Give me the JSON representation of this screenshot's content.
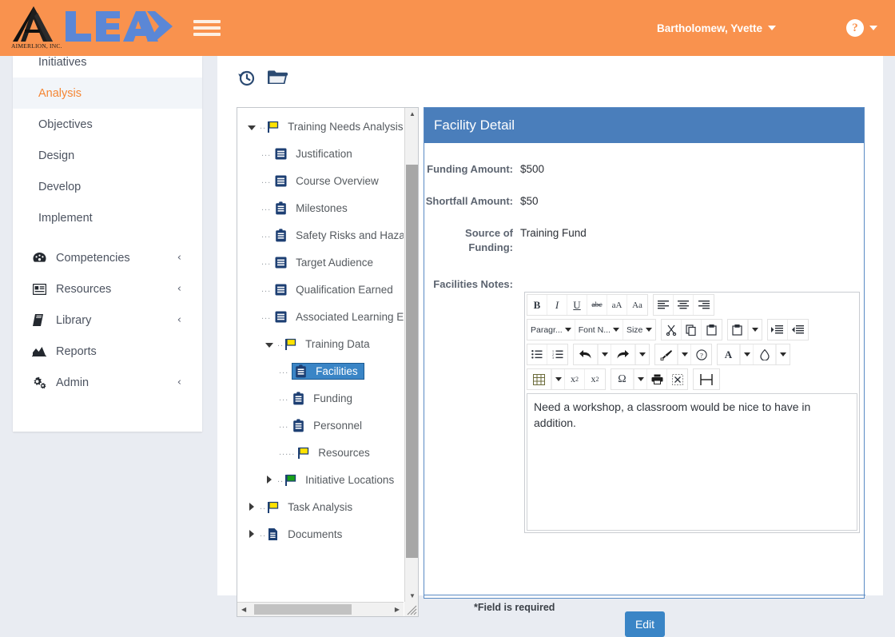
{
  "header": {
    "logo_caption": "AIMERLION, INC.",
    "logo_word": "LEAD",
    "menu_icon": "hamburger-icon",
    "user_name": "Bartholomew, Yvette",
    "help_icon": "question-mark-icon"
  },
  "sidebar": {
    "items": [
      {
        "label": "Initiatives",
        "active": false,
        "icon": null,
        "chevron": false
      },
      {
        "label": "Analysis",
        "active": true,
        "icon": null,
        "chevron": false
      },
      {
        "label": "Objectives",
        "active": false,
        "icon": null,
        "chevron": false
      },
      {
        "label": "Design",
        "active": false,
        "icon": null,
        "chevron": false
      },
      {
        "label": "Develop",
        "active": false,
        "icon": null,
        "chevron": false
      },
      {
        "label": "Implement",
        "active": false,
        "icon": null,
        "chevron": false
      },
      {
        "label": "Competencies",
        "active": false,
        "icon": "dashboard-icon",
        "chevron": true
      },
      {
        "label": "Resources",
        "active": false,
        "icon": "id-card-icon",
        "chevron": true
      },
      {
        "label": "Library",
        "active": false,
        "icon": "book-icon",
        "chevron": true
      },
      {
        "label": "Reports",
        "active": false,
        "icon": "chart-area-icon",
        "chevron": false
      },
      {
        "label": "Admin",
        "active": false,
        "icon": "gears-icon",
        "chevron": true
      }
    ],
    "chevron_glyph": "‹"
  },
  "content_toolbar": {
    "history_icon": "history-clock-icon",
    "folder_icon": "open-folder-icon"
  },
  "tree": {
    "nodes": [
      {
        "label": "Training Needs Analysis",
        "indent": 0,
        "toggle": "down",
        "icon": "flag-yellow-icon",
        "selected": false
      },
      {
        "label": "Justification",
        "indent": 1,
        "toggle": "none",
        "icon": "list-doc-icon",
        "selected": false
      },
      {
        "label": "Course Overview",
        "indent": 1,
        "toggle": "none",
        "icon": "list-doc-icon",
        "selected": false
      },
      {
        "label": "Milestones",
        "indent": 1,
        "toggle": "none",
        "icon": "clipboard-icon",
        "selected": false
      },
      {
        "label": "Safety Risks and Haza",
        "indent": 1,
        "toggle": "none",
        "icon": "clipboard-icon",
        "selected": false
      },
      {
        "label": "Target Audience",
        "indent": 1,
        "toggle": "none",
        "icon": "list-doc-icon",
        "selected": false
      },
      {
        "label": "Qualification Earned",
        "indent": 1,
        "toggle": "none",
        "icon": "list-doc-icon",
        "selected": false
      },
      {
        "label": "Associated Learning E",
        "indent": 1,
        "toggle": "none",
        "icon": "list-doc-icon",
        "selected": false
      },
      {
        "label": "Training Data",
        "indent": 1,
        "toggle": "down",
        "icon": "flag-yellow-icon",
        "selected": false
      },
      {
        "label": "Facilities",
        "indent": 2,
        "toggle": "none",
        "icon": "clipboard-icon",
        "selected": true
      },
      {
        "label": "Funding",
        "indent": 2,
        "toggle": "none",
        "icon": "clipboard-icon",
        "selected": false
      },
      {
        "label": "Personnel",
        "indent": 2,
        "toggle": "none",
        "icon": "clipboard-icon",
        "selected": false
      },
      {
        "label": "Resources",
        "indent": 2,
        "toggle": "none",
        "icon": "flag-yellow-icon",
        "selected": false
      },
      {
        "label": "Initiative Locations",
        "indent": 1,
        "toggle": "right",
        "icon": "flag-green-icon",
        "selected": false
      },
      {
        "label": "Task Analysis",
        "indent": 0,
        "toggle": "right",
        "icon": "flag-yellow-icon",
        "selected": false
      },
      {
        "label": "Documents",
        "indent": 0,
        "toggle": "right",
        "icon": "document-icon",
        "selected": false
      }
    ]
  },
  "detail": {
    "title": "Facility Detail",
    "fields": [
      {
        "label": "Funding Amount:",
        "value": "$500"
      },
      {
        "label": "Shortfall Amount:",
        "value": "$50"
      },
      {
        "label": "Source of Funding:",
        "value": "Training Fund"
      }
    ],
    "notes_label": "Facilities Notes:",
    "notes_text": "Need a workshop, a classroom would be nice to have in addition.",
    "required_note": "*Field is required",
    "edit_label": "Edit",
    "accent_header": "#4a7ebb",
    "accent_button": "#3a85c6"
  },
  "editor_toolbar": {
    "row1": [
      {
        "group": [
          {
            "name": "bold-button",
            "label": "B"
          },
          {
            "name": "italic-button",
            "label": "I"
          },
          {
            "name": "underline-button",
            "label": "U"
          },
          {
            "name": "strikethrough-button",
            "label": "abc"
          },
          {
            "name": "uppercase-button",
            "label": "aA"
          },
          {
            "name": "change-case-button",
            "label": "Aa"
          }
        ]
      },
      {
        "group": [
          {
            "name": "align-left-button",
            "label": "align-left-icon"
          },
          {
            "name": "align-center-button",
            "label": "align-center-icon"
          },
          {
            "name": "align-right-button",
            "label": "align-right-icon"
          }
        ]
      }
    ],
    "row2": [
      {
        "group": [
          {
            "name": "paragraph-format-select",
            "label": "Paragr..."
          },
          {
            "name": "font-name-select",
            "label": "Font N..."
          },
          {
            "name": "font-size-select",
            "label": "Size"
          }
        ]
      },
      {
        "group": [
          {
            "name": "cut-button",
            "label": "scissors-icon"
          },
          {
            "name": "copy-button",
            "label": "copy-icon"
          },
          {
            "name": "paste-button",
            "label": "clipboard-icon"
          }
        ]
      },
      {
        "group": [
          {
            "name": "paste-options-button",
            "label": "clipboard-dropdown-icon"
          }
        ]
      },
      {
        "group": [
          {
            "name": "indent-button",
            "label": "indent-icon"
          },
          {
            "name": "outdent-button",
            "label": "outdent-icon"
          }
        ]
      }
    ],
    "row3": [
      {
        "group": [
          {
            "name": "bullet-list-button",
            "label": "bullet-list-icon"
          },
          {
            "name": "numbered-list-button",
            "label": "numbered-list-icon"
          }
        ]
      },
      {
        "group": [
          {
            "name": "undo-button",
            "label": "undo-icon"
          },
          {
            "name": "redo-button",
            "label": "redo-icon"
          }
        ]
      },
      {
        "group": [
          {
            "name": "format-painter-button",
            "label": "paintbrush-icon"
          },
          {
            "name": "help-button",
            "label": "question-circle-icon"
          }
        ]
      },
      {
        "group": [
          {
            "name": "text-color-button",
            "label": "A"
          },
          {
            "name": "highlight-color-button",
            "label": "droplet-icon"
          }
        ]
      }
    ],
    "row4": [
      {
        "group": [
          {
            "name": "table-button",
            "label": "table-icon"
          },
          {
            "name": "subscript-button",
            "label": "x2"
          },
          {
            "name": "superscript-button",
            "label": "x2"
          }
        ]
      },
      {
        "group": [
          {
            "name": "special-character-button",
            "label": "omega-icon"
          },
          {
            "name": "print-button",
            "label": "printer-icon"
          },
          {
            "name": "fullscreen-button",
            "label": "expand-icon"
          }
        ]
      },
      {
        "group": [
          {
            "name": "page-break-button",
            "label": "page-break-icon"
          }
        ]
      }
    ]
  }
}
